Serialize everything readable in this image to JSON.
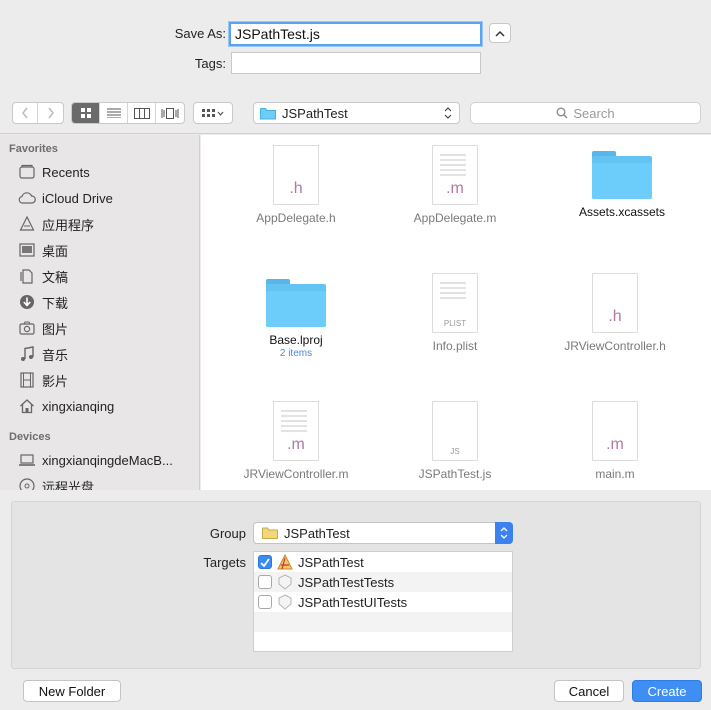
{
  "save_as": {
    "label": "Save As:",
    "value": "JSPathTest.js"
  },
  "tags": {
    "label": "Tags:",
    "value": ""
  },
  "toolbar": {
    "location": "JSPathTest",
    "search_placeholder": "Search"
  },
  "sidebar": {
    "favorites_header": "Favorites",
    "favorites": [
      "Recents",
      "iCloud Drive",
      "应用程序",
      "桌面",
      "文稿",
      "下载",
      "图片",
      "音乐",
      "影片",
      "xingxianqing"
    ],
    "devices_header": "Devices",
    "devices": [
      "xingxianqingdeMacB...",
      "远程光盘"
    ]
  },
  "files": [
    {
      "name": "AppDelegate.h",
      "ext": ".h"
    },
    {
      "name": "AppDelegate.m",
      "ext": ".m"
    },
    {
      "name": "Assets.xcassets",
      "ext": ""
    },
    {
      "name": "Base.lproj",
      "ext": "",
      "sub": "2 items"
    },
    {
      "name": "Info.plist",
      "ext": "PLIST"
    },
    {
      "name": "JRViewController.h",
      "ext": ".h"
    },
    {
      "name": "JRViewController.m",
      "ext": ".m"
    },
    {
      "name": "JSPathTest.js",
      "ext": "JS"
    },
    {
      "name": "main.m",
      "ext": ".m"
    }
  ],
  "group": {
    "label": "Group",
    "value": "JSPathTest"
  },
  "targets": {
    "label": "Targets",
    "items": [
      {
        "name": "JSPathTest",
        "checked": true
      },
      {
        "name": "JSPathTestTests",
        "checked": false
      },
      {
        "name": "JSPathTestUITests",
        "checked": false
      }
    ]
  },
  "buttons": {
    "new_folder": "New Folder",
    "cancel": "Cancel",
    "create": "Create"
  },
  "colors": {
    "accent": "#3f8ef4",
    "folder": "#63c4f3"
  }
}
